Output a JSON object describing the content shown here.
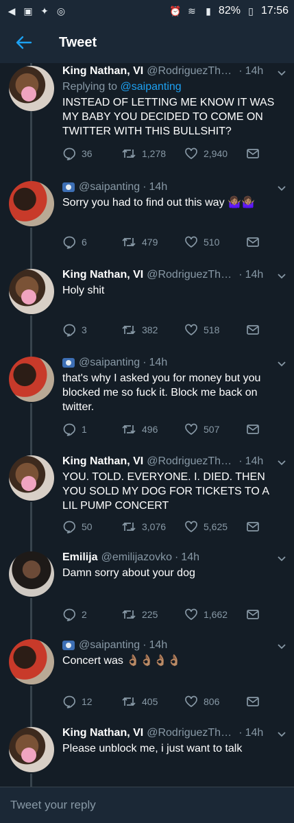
{
  "status_bar": {
    "battery": "82%",
    "time": "17:56"
  },
  "app_bar": {
    "title": "Tweet"
  },
  "tweets": [
    {
      "name": "King Nathan, VI",
      "handle": "@RodriguezThaG...",
      "time": "14h",
      "replying_label": "Replying to",
      "replying_to": "@saipanting",
      "text": "INSTEAD OF LETTING ME KNOW IT WAS MY BABY YOU DECIDED TO COME ON TWITTER WITH THIS BULLSHIT?",
      "replies": "36",
      "retweets": "1,278",
      "likes": "2,940"
    },
    {
      "name": "",
      "handle": "@saipanting",
      "time": "14h",
      "text": "Sorry you had to find out this way 🤷🏽‍♀️🤷🏽‍♀️",
      "replies": "6",
      "retweets": "479",
      "likes": "510"
    },
    {
      "name": "King Nathan, VI",
      "handle": "@RodriguezThaG...",
      "time": "14h",
      "text": "Holy shit",
      "replies": "3",
      "retweets": "382",
      "likes": "518"
    },
    {
      "name": "",
      "handle": "@saipanting",
      "time": "14h",
      "text": "that's why I asked you for money but you blocked me so fuck it. Block me back on twitter.",
      "replies": "1",
      "retweets": "496",
      "likes": "507"
    },
    {
      "name": "King Nathan, VI",
      "handle": "@RodriguezThaG...",
      "time": "14h",
      "text": "YOU. TOLD. EVERYONE. I. DIED. THEN YOU SOLD MY DOG FOR TICKETS TO A LIL PUMP CONCERT",
      "replies": "50",
      "retweets": "3,076",
      "likes": "5,625"
    },
    {
      "name": "Emilija",
      "handle": "@emilijazovko",
      "time": "14h",
      "text": "Damn sorry about your dog",
      "replies": "2",
      "retweets": "225",
      "likes": "1,662"
    },
    {
      "name": "",
      "handle": "@saipanting",
      "time": "14h",
      "text": "Concert was 👌🏽👌🏽👌🏽👌🏽",
      "replies": "12",
      "retweets": "405",
      "likes": "806"
    },
    {
      "name": "King Nathan, VI",
      "handle": "@RodriguezThaG...",
      "time": "14h",
      "text": "Please unblock me, i just want to talk"
    }
  ],
  "compose": {
    "placeholder": "Tweet your reply"
  },
  "colors": {
    "background": "#141d26",
    "bar": "#1b2836",
    "secondary_text": "#8899a6",
    "accent": "#1da1f2"
  },
  "icons": [
    "back-arrow-icon",
    "reply-icon",
    "retweet-icon",
    "like-icon",
    "dm-icon",
    "chevron-down-icon",
    "lock-badge-icon",
    "wifi-icon",
    "signal-icon",
    "battery-icon",
    "alarm-icon"
  ]
}
